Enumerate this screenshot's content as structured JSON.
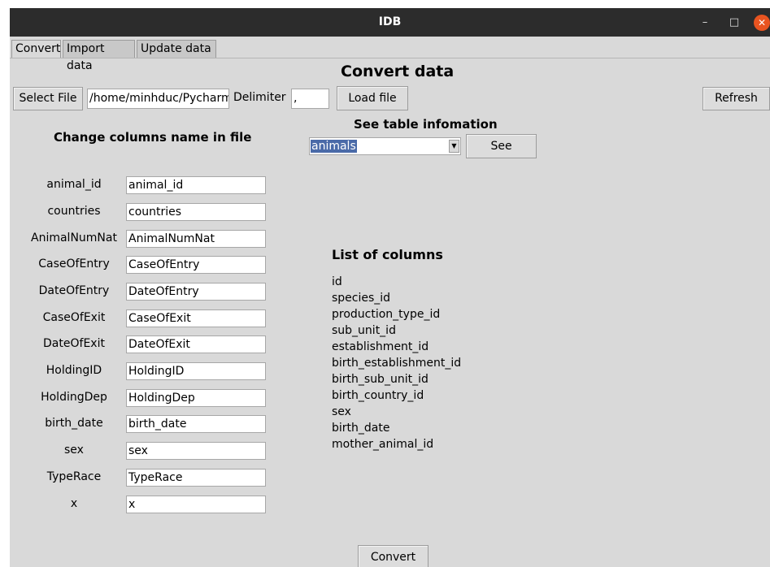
{
  "window": {
    "title": "IDB",
    "min_glyph": "–",
    "max_glyph": "□",
    "close_glyph": "✕"
  },
  "tabs": [
    "Convert",
    "Import data",
    "Update data"
  ],
  "page_title": "Convert data",
  "file_row": {
    "select_label": "Select File",
    "path_value": "/home/minhduc/Pycharm",
    "delimiter_label": "Delimiter",
    "delimiter_value": ",",
    "load_label": "Load file",
    "refresh_label": "Refresh"
  },
  "table_info": {
    "heading": "See table infomation",
    "selected_table": "animals",
    "see_label": "See"
  },
  "rename": {
    "heading": "Change columns name in file",
    "rows": [
      {
        "label": "animal_id",
        "value": "animal_id"
      },
      {
        "label": "countries",
        "value": "countries"
      },
      {
        "label": "AnimalNumNat",
        "value": "AnimalNumNat"
      },
      {
        "label": "CaseOfEntry",
        "value": "CaseOfEntry"
      },
      {
        "label": "DateOfEntry",
        "value": "DateOfEntry"
      },
      {
        "label": "CaseOfExit",
        "value": "CaseOfExit"
      },
      {
        "label": "DateOfExit",
        "value": "DateOfExit"
      },
      {
        "label": "HoldingID",
        "value": "HoldingID"
      },
      {
        "label": "HoldingDep",
        "value": "HoldingDep"
      },
      {
        "label": "birth_date",
        "value": "birth_date"
      },
      {
        "label": "sex",
        "value": "sex"
      },
      {
        "label": "TypeRace",
        "value": "TypeRace"
      },
      {
        "label": "x",
        "value": "x"
      }
    ]
  },
  "columns": {
    "heading": "List of columns",
    "items": [
      "id",
      "species_id",
      "production_type_id",
      "sub_unit_id",
      "establishment_id",
      "birth_establishment_id",
      "birth_sub_unit_id",
      "birth_country_id",
      "sex",
      "birth_date",
      "mother_animal_id"
    ]
  },
  "convert_label": "Convert"
}
